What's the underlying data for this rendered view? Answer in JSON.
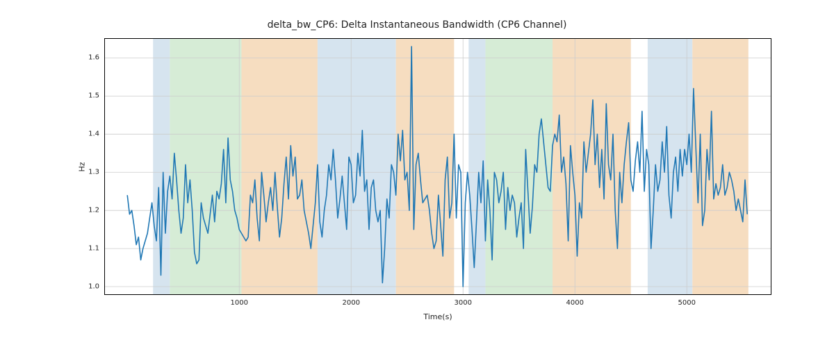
{
  "chart_data": {
    "type": "line",
    "title": "delta_bw_CP6: Delta Instantaneous Bandwidth (CP6 Channel)",
    "xlabel": "Time(s)",
    "ylabel": "Hz",
    "xlim": [
      -200,
      5750
    ],
    "ylim": [
      0.98,
      1.65
    ],
    "xticks": [
      1000,
      2000,
      3000,
      4000,
      5000
    ],
    "yticks": [
      1.0,
      1.1,
      1.2,
      1.3,
      1.4,
      1.5,
      1.6
    ],
    "line_color": "#1f77b4",
    "grid_color": "#cccccc",
    "shaded_spans": [
      {
        "x0": 230,
        "x1": 380,
        "color": "#d6e4ef"
      },
      {
        "x0": 380,
        "x1": 1020,
        "color": "#d6ecd6"
      },
      {
        "x0": 1020,
        "x1": 1700,
        "color": "#f6ddc0"
      },
      {
        "x0": 1700,
        "x1": 2400,
        "color": "#d6e4ef"
      },
      {
        "x0": 2400,
        "x1": 2920,
        "color": "#f6ddc0"
      },
      {
        "x0": 3050,
        "x1": 3200,
        "color": "#d6e4ef"
      },
      {
        "x0": 3200,
        "x1": 3800,
        "color": "#d6ecd6"
      },
      {
        "x0": 3800,
        "x1": 4500,
        "color": "#f6ddc0"
      },
      {
        "x0": 4650,
        "x1": 5050,
        "color": "#d6e4ef"
      },
      {
        "x0": 5050,
        "x1": 5550,
        "color": "#f6ddc0"
      }
    ],
    "series": [
      {
        "name": "delta_bw_CP6",
        "x_start": 0,
        "x_step": 20,
        "values": [
          1.24,
          1.19,
          1.2,
          1.16,
          1.11,
          1.13,
          1.07,
          1.1,
          1.12,
          1.14,
          1.18,
          1.22,
          1.16,
          1.12,
          1.26,
          1.03,
          1.3,
          1.14,
          1.25,
          1.29,
          1.23,
          1.35,
          1.28,
          1.2,
          1.14,
          1.18,
          1.32,
          1.22,
          1.28,
          1.2,
          1.09,
          1.06,
          1.07,
          1.22,
          1.18,
          1.16,
          1.14,
          1.19,
          1.24,
          1.17,
          1.25,
          1.23,
          1.27,
          1.36,
          1.22,
          1.39,
          1.28,
          1.25,
          1.2,
          1.18,
          1.15,
          1.14,
          1.13,
          1.12,
          1.13,
          1.24,
          1.22,
          1.28,
          1.18,
          1.12,
          1.3,
          1.24,
          1.17,
          1.22,
          1.26,
          1.2,
          1.3,
          1.21,
          1.13,
          1.18,
          1.27,
          1.34,
          1.23,
          1.37,
          1.29,
          1.34,
          1.23,
          1.24,
          1.28,
          1.2,
          1.17,
          1.14,
          1.1,
          1.16,
          1.22,
          1.32,
          1.17,
          1.13,
          1.2,
          1.24,
          1.32,
          1.28,
          1.36,
          1.28,
          1.18,
          1.23,
          1.29,
          1.22,
          1.15,
          1.34,
          1.32,
          1.22,
          1.24,
          1.35,
          1.29,
          1.41,
          1.25,
          1.28,
          1.15,
          1.26,
          1.28,
          1.2,
          1.17,
          1.2,
          1.01,
          1.1,
          1.23,
          1.18,
          1.32,
          1.3,
          1.24,
          1.4,
          1.33,
          1.41,
          1.28,
          1.3,
          1.2,
          1.63,
          1.15,
          1.32,
          1.35,
          1.28,
          1.22,
          1.23,
          1.24,
          1.2,
          1.14,
          1.1,
          1.12,
          1.24,
          1.16,
          1.08,
          1.28,
          1.34,
          1.18,
          1.22,
          1.4,
          1.18,
          1.32,
          1.3,
          1.0,
          1.22,
          1.3,
          1.24,
          1.15,
          1.05,
          1.17,
          1.3,
          1.22,
          1.33,
          1.12,
          1.28,
          1.2,
          1.07,
          1.3,
          1.28,
          1.22,
          1.25,
          1.3,
          1.15,
          1.26,
          1.2,
          1.24,
          1.22,
          1.13,
          1.18,
          1.22,
          1.1,
          1.36,
          1.25,
          1.14,
          1.21,
          1.32,
          1.3,
          1.4,
          1.44,
          1.38,
          1.32,
          1.26,
          1.25,
          1.37,
          1.4,
          1.38,
          1.45,
          1.3,
          1.34,
          1.27,
          1.12,
          1.37,
          1.3,
          1.24,
          1.08,
          1.22,
          1.18,
          1.38,
          1.3,
          1.35,
          1.4,
          1.49,
          1.32,
          1.4,
          1.26,
          1.36,
          1.23,
          1.48,
          1.32,
          1.28,
          1.4,
          1.2,
          1.1,
          1.3,
          1.22,
          1.32,
          1.38,
          1.43,
          1.28,
          1.25,
          1.33,
          1.38,
          1.3,
          1.46,
          1.25,
          1.36,
          1.32,
          1.1,
          1.2,
          1.32,
          1.25,
          1.28,
          1.38,
          1.3,
          1.42,
          1.24,
          1.18,
          1.3,
          1.34,
          1.25,
          1.36,
          1.29,
          1.36,
          1.32,
          1.4,
          1.3,
          1.52,
          1.37,
          1.22,
          1.4,
          1.16,
          1.2,
          1.36,
          1.28,
          1.46,
          1.23,
          1.27,
          1.24,
          1.26,
          1.32,
          1.24,
          1.26,
          1.3,
          1.28,
          1.25,
          1.2,
          1.23,
          1.2,
          1.17,
          1.28,
          1.19
        ]
      }
    ]
  }
}
